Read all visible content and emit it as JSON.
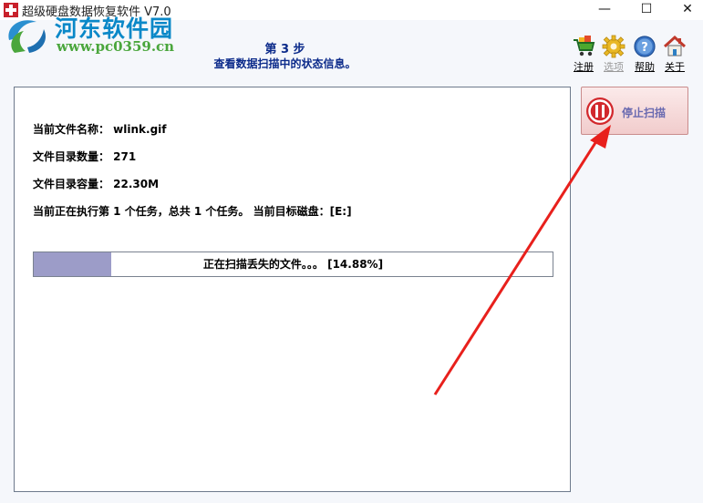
{
  "window": {
    "title": "超级硬盘数据恢复软件 V7.0",
    "min_glyph": "—",
    "max_glyph": "☐",
    "close_glyph": "✕"
  },
  "watermark": {
    "title": "河东软件园",
    "url": "www.pc0359.cn"
  },
  "step": {
    "title": "第 3 步",
    "description": "查看数据扫描中的状态信息。"
  },
  "toolbar": [
    {
      "label": "注册",
      "icon": "cart-icon",
      "enabled": true
    },
    {
      "label": "选项",
      "icon": "gear-icon",
      "enabled": false
    },
    {
      "label": "帮助",
      "icon": "help-icon",
      "enabled": true
    },
    {
      "label": "关于",
      "icon": "home-icon",
      "enabled": true
    }
  ],
  "info": {
    "current_file": "当前文件名称： wlink.gif",
    "dir_count": "文件目录数量： 271",
    "dir_size": "文件目录容量： 22.30M",
    "task_status": "当前正在执行第 1 个任务，总共 1 个任务。 当前目标磁盘：[E:]"
  },
  "progress": {
    "percent": 14.88,
    "text": "正在扫描丢失的文件。。。 [14.88%]"
  },
  "stop_button": {
    "label": "停止扫描"
  },
  "colors": {
    "accent_text": "#0b2a8a",
    "progress_fill": "#9c9cc8",
    "arrow": "#e8201c"
  }
}
